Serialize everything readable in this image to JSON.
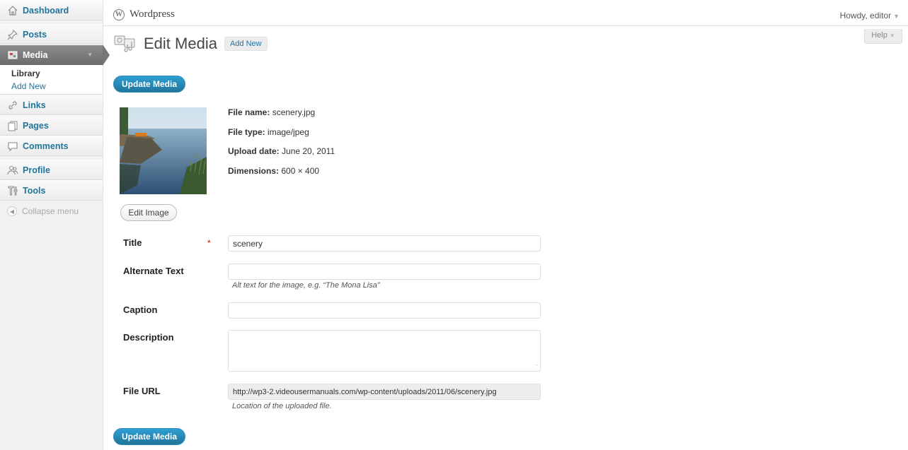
{
  "sidebar": {
    "items": {
      "dashboard": "Dashboard",
      "posts": "Posts",
      "media": "Media",
      "links": "Links",
      "pages": "Pages",
      "comments": "Comments",
      "profile": "Profile",
      "tools": "Tools"
    },
    "media_submenu": {
      "library": "Library",
      "add_new": "Add New"
    },
    "collapse_label": "Collapse menu"
  },
  "header": {
    "site_name": "Wordpress",
    "howdy": "Howdy, editor",
    "help": "Help"
  },
  "page": {
    "title": "Edit Media",
    "add_new": "Add New",
    "update_button": "Update Media",
    "edit_image_button": "Edit Image"
  },
  "file_info": {
    "name_label": "File name:",
    "name_value": "scenery.jpg",
    "type_label": "File type:",
    "type_value": "image/jpeg",
    "date_label": "Upload date:",
    "date_value": "June 20, 2011",
    "dim_label": "Dimensions:",
    "dim_value": "600 × 400"
  },
  "form": {
    "title_label": "Title",
    "required_mark": "*",
    "title_value": "scenery",
    "alt_label": "Alternate Text",
    "alt_value": "",
    "alt_help": "Alt text for the image, e.g. “The Mona Lisa”",
    "caption_label": "Caption",
    "caption_value": "",
    "description_label": "Description",
    "description_value": "",
    "file_url_label": "File URL",
    "file_url_value": "http://wp3-2.videousermanuals.com/wp-content/uploads/2011/06/scenery.jpg",
    "file_url_help": "Location of the uploaded file."
  },
  "colors": {
    "link": "#21759b",
    "primary_button": "#21759b",
    "active_menu": "#777777",
    "required": "#dd0000"
  }
}
